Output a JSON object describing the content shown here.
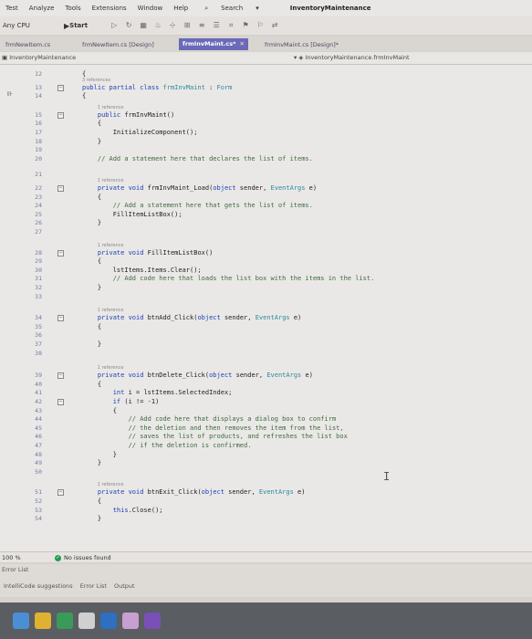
{
  "menu": {
    "items": [
      "Test",
      "Analyze",
      "Tools",
      "Extensions",
      "Window",
      "Help"
    ],
    "search_label": "Search",
    "app_title": "InventoryMaintenance"
  },
  "toolbar": {
    "platform": "Any CPU",
    "start_label": "Start"
  },
  "tabs": [
    {
      "label": "frmNewItem.cs"
    },
    {
      "label": "frmNewItem.cs [Design]"
    },
    {
      "label": "frmInvMaint.cs*"
    },
    {
      "label": "frmInvMaint.cs [Design]*"
    }
  ],
  "nav": {
    "left": "InventoryMaintenance",
    "right": "InventoryMaintenance.frmInvMaint"
  },
  "editor": {
    "lines": [
      {
        "n": "12",
        "html": "{"
      },
      {
        "n": "13",
        "html": "<span class=\"kw\">public partial class</span> <span class=\"ty\">frmInvMaint</span> : <span class=\"ty\">Form</span>"
      },
      {
        "n": "14",
        "html": "{"
      },
      {
        "n": "15",
        "html": "    <span class=\"kw\">public</span> frmInvMaint()"
      },
      {
        "n": "16",
        "html": "    {"
      },
      {
        "n": "17",
        "html": "        InitializeComponent();"
      },
      {
        "n": "18",
        "html": "    }"
      },
      {
        "n": "19",
        "html": ""
      },
      {
        "n": "20",
        "html": "    <span class=\"cm\">// Add a statement here that declares the list of items.</span>"
      },
      {
        "n": "21",
        "html": ""
      },
      {
        "n": "22",
        "html": "    <span class=\"kw\">private void</span> frmInvMaint_Load(<span class=\"kw\">object</span> sender, <span class=\"ty\">EventArgs</span> e)"
      },
      {
        "n": "23",
        "html": "    {"
      },
      {
        "n": "24",
        "html": "        <span class=\"cm\">// Add a statement here that gets the list of items.</span>"
      },
      {
        "n": "25",
        "html": "        FillItemListBox();"
      },
      {
        "n": "26",
        "html": "    }"
      },
      {
        "n": "27",
        "html": ""
      },
      {
        "n": "28",
        "html": "    <span class=\"kw\">private void</span> FillItemListBox()"
      },
      {
        "n": "29",
        "html": "    {"
      },
      {
        "n": "30",
        "html": "        lstItems.Items.Clear();"
      },
      {
        "n": "31",
        "html": "        <span class=\"cm\">// Add code here that loads the list box with the items in the list.</span>"
      },
      {
        "n": "32",
        "html": "    }"
      },
      {
        "n": "33",
        "html": ""
      },
      {
        "n": "34",
        "html": "    <span class=\"kw\">private void</span> btnAdd_Click(<span class=\"kw\">object</span> sender, <span class=\"ty\">EventArgs</span> e)"
      },
      {
        "n": "35",
        "html": "    {"
      },
      {
        "n": "36",
        "html": ""
      },
      {
        "n": "37",
        "html": "    }"
      },
      {
        "n": "38",
        "html": ""
      },
      {
        "n": "39",
        "html": "    <span class=\"kw\">private void</span> btnDelete_Click(<span class=\"kw\">object</span> sender, <span class=\"ty\">EventArgs</span> e)"
      },
      {
        "n": "40",
        "html": "    {"
      },
      {
        "n": "41",
        "html": "        <span class=\"kw\">int</span> i = lstItems.SelectedIndex;"
      },
      {
        "n": "42",
        "html": "        <span class=\"kw\">if</span> (i != -1)"
      },
      {
        "n": "43",
        "html": "        {"
      },
      {
        "n": "44",
        "html": "            <span class=\"cm\">// Add code here that displays a dialog box to confirm</span>"
      },
      {
        "n": "45",
        "html": "            <span class=\"cm\">// the deletion and then removes the item from the list,</span>"
      },
      {
        "n": "46",
        "html": "            <span class=\"cm\">// saves the list of products, and refreshes the list box</span>"
      },
      {
        "n": "47",
        "html": "            <span class=\"cm\">// if the deletion is confirmed.</span>"
      },
      {
        "n": "48",
        "html": "        }"
      },
      {
        "n": "49",
        "html": "    }"
      },
      {
        "n": "50",
        "html": ""
      },
      {
        "n": "51",
        "html": "    <span class=\"kw\">private void</span> btnExit_Click(<span class=\"kw\">object</span> sender, <span class=\"ty\">EventArgs</span> e)"
      },
      {
        "n": "52",
        "html": "    {"
      },
      {
        "n": "53",
        "html": "        <span class=\"kw\">this</span>.Close();"
      },
      {
        "n": "54",
        "html": "    }"
      }
    ],
    "ref_3": "3 references",
    "ref_1": "1 reference"
  },
  "status": {
    "zoom": "100 %",
    "issues": "No issues found"
  },
  "errorlist": {
    "title": "Error List",
    "tabs": [
      "IntelliCode suggestions",
      "Error List",
      "Output"
    ]
  },
  "colors": {
    "accent": "#6a6ab8",
    "keyword": "#1a3fb8",
    "type": "#2b8a9a",
    "comment": "#3d6b3d"
  }
}
